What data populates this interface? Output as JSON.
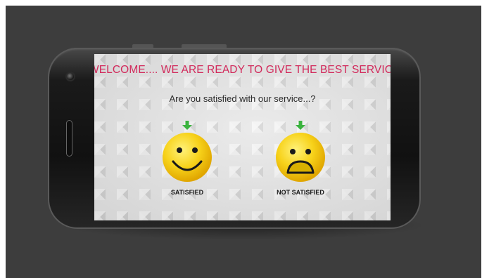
{
  "app": {
    "banner": "WELCOME.... WE ARE READY TO GIVE THE BEST SERVICE ....",
    "question": "Are you satisfied with our service...?"
  },
  "options": [
    {
      "label": "SATISFIED",
      "icon": "smiley-face-icon",
      "indicator": "green-down-arrow-icon"
    },
    {
      "label": "NOT SATISFIED",
      "icon": "sad-face-icon",
      "indicator": "green-down-arrow-icon"
    }
  ],
  "colors": {
    "banner_text": "#d2295b",
    "face_yellow": "#f7d21a",
    "arrow_green": "#3bb33f",
    "backdrop": "#3d3d3d"
  }
}
